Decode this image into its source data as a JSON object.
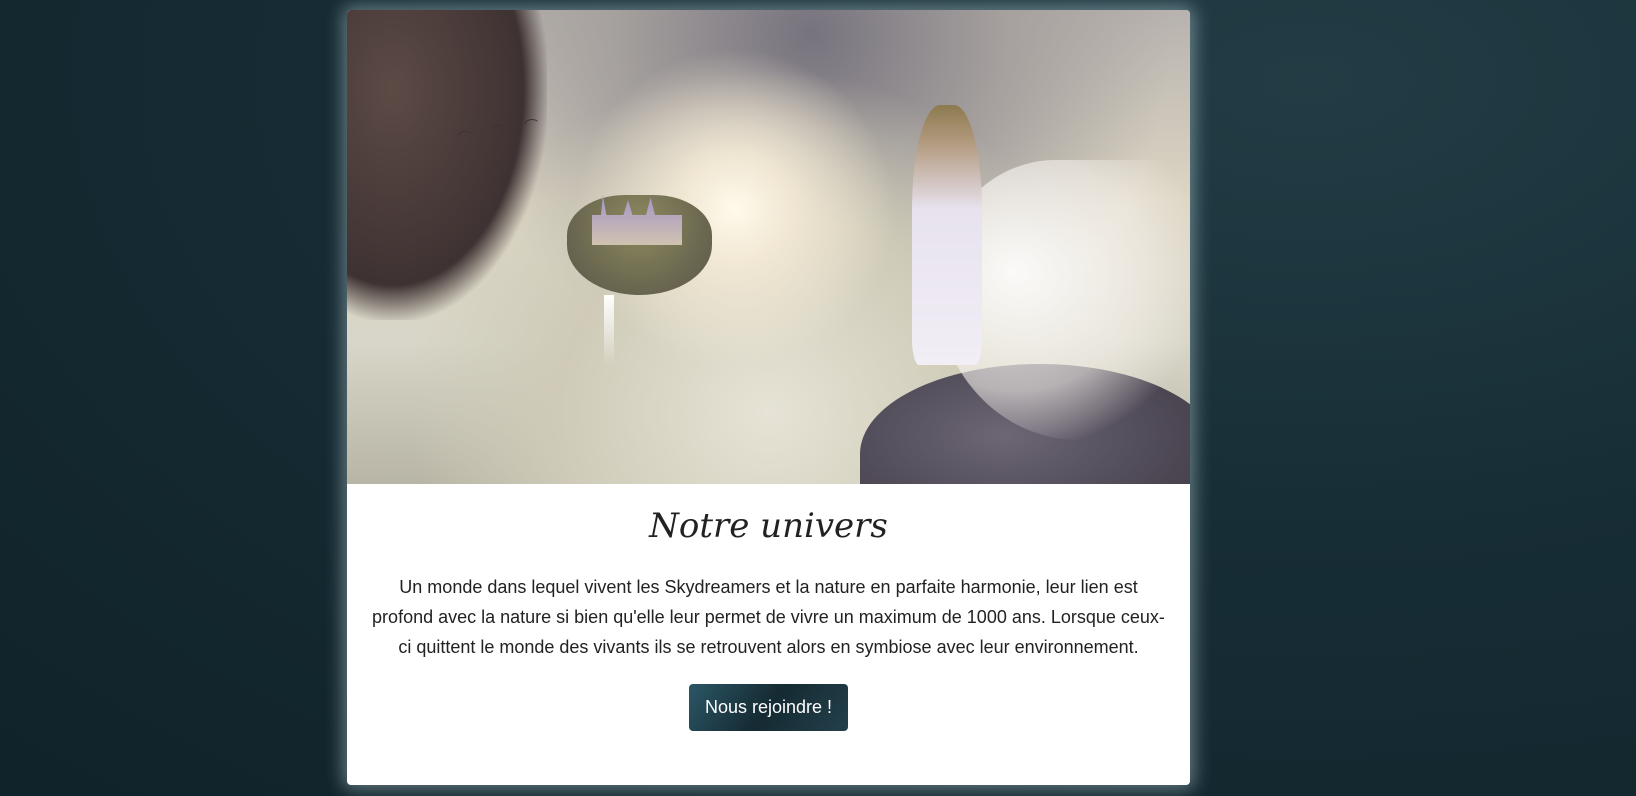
{
  "section": {
    "title": "Notre univers",
    "description": "Un monde dans lequel vivent les Skydreamers et la nature en parfaite harmonie, leur lien est profond avec la nature si bien qu'elle leur permet de vivre un maximum de 1000 ans. Lorsque ceux-ci quittent le monde des vivants ils se retrouvent alors en symbiose avec leur environnement.",
    "button_label": "Nous rejoindre !"
  },
  "hero_image": {
    "icon": "fantasy-sky-castle-image"
  }
}
